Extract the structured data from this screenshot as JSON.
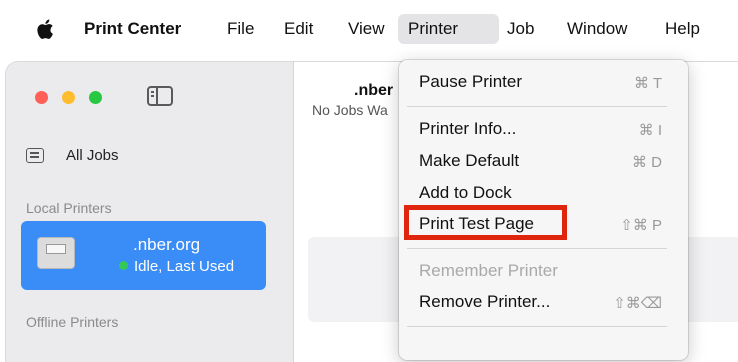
{
  "menubar": {
    "apple_icon": "apple-logo-icon",
    "app_name": "Print Center",
    "items": [
      "File",
      "Edit",
      "View",
      "Printer",
      "Job",
      "Window",
      "Help"
    ],
    "active": "Printer"
  },
  "window": {
    "sidebar": {
      "all_jobs": "All Jobs",
      "local_header": "Local Printers",
      "printer": {
        "name": ".nber.org",
        "status": "Idle, Last Used",
        "status_color": "#34c759"
      },
      "offline_header": "Offline Printers"
    },
    "content": {
      "title": ".nber",
      "subtitle": "No Jobs Wa"
    }
  },
  "printer_menu": {
    "items": [
      {
        "label": "Pause Printer",
        "shortcut": "⌘ T",
        "enabled": true
      },
      {
        "label": "Printer Info...",
        "shortcut": "⌘ I",
        "enabled": true
      },
      {
        "label": "Make Default",
        "shortcut": "⌘ D",
        "enabled": true
      },
      {
        "label": "Add to Dock",
        "shortcut": "",
        "enabled": true
      },
      {
        "label": "Print Test Page",
        "shortcut": "⇧⌘ P",
        "enabled": true,
        "highlighted": true
      },
      {
        "label": "Remember Printer",
        "shortcut": "",
        "enabled": false
      },
      {
        "label": "Remove Printer...",
        "shortcut": "⇧⌘⌫",
        "enabled": true
      }
    ]
  },
  "colors": {
    "selection": "#3a8cf7",
    "annotation": "#e0250f",
    "menu_active": "#e4e4e6"
  }
}
